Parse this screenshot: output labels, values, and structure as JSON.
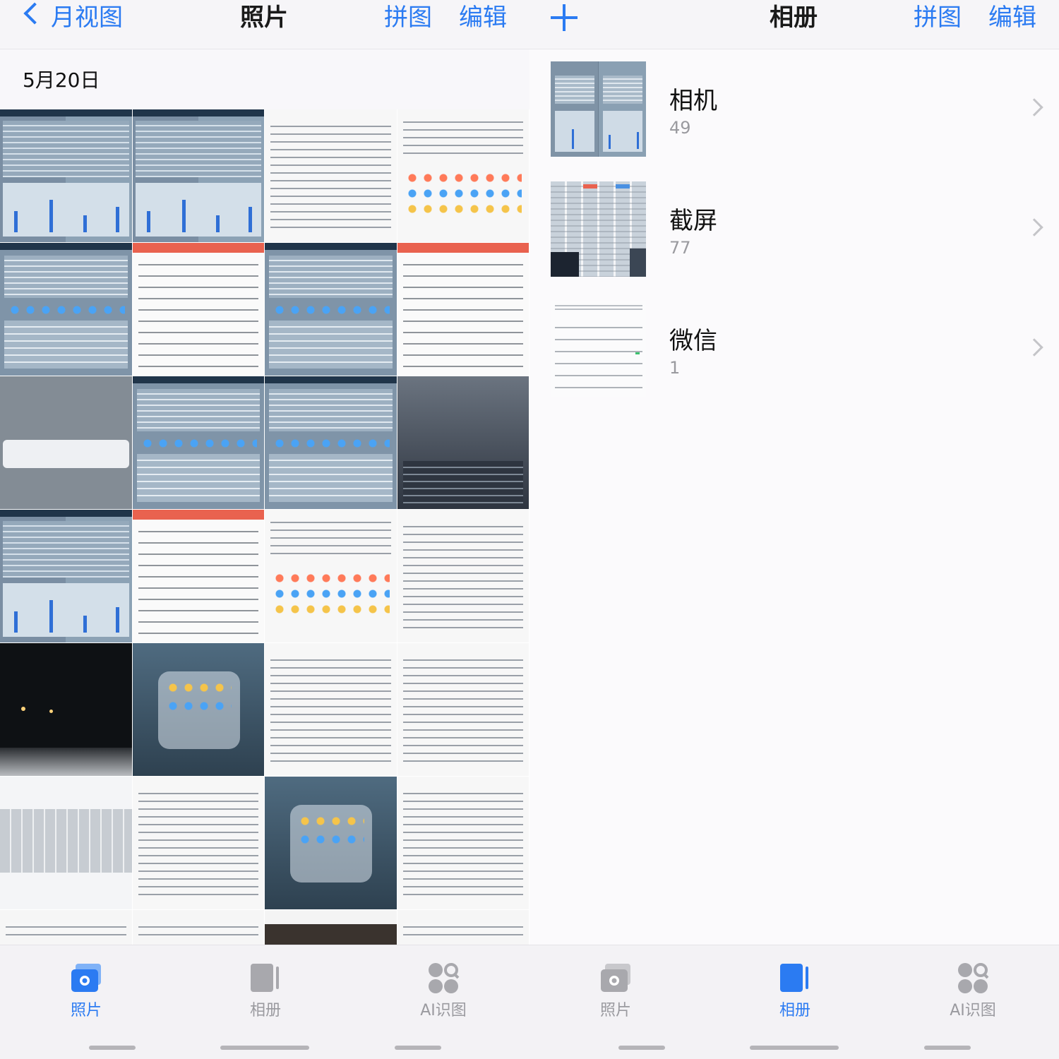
{
  "left": {
    "header": {
      "back_label": "月视图",
      "title": "照片",
      "collage_label": "拼图",
      "edit_label": "编辑"
    },
    "date_label": "5月20日",
    "tabs": [
      {
        "label": "照片",
        "icon": "photos-icon",
        "active": true
      },
      {
        "label": "相册",
        "icon": "albums-icon",
        "active": false
      },
      {
        "label": "AI识图",
        "icon": "ai-recognize-icon",
        "active": false
      }
    ]
  },
  "right": {
    "header": {
      "title": "相册",
      "collage_label": "拼图",
      "edit_label": "编辑"
    },
    "albums": [
      {
        "name": "相机",
        "count": "49"
      },
      {
        "name": "截屏",
        "count": "77"
      },
      {
        "name": "微信",
        "count": "1"
      }
    ],
    "tabs": [
      {
        "label": "照片",
        "icon": "photos-icon",
        "active": false
      },
      {
        "label": "相册",
        "icon": "albums-icon",
        "active": true
      },
      {
        "label": "AI识图",
        "icon": "ai-recognize-icon",
        "active": false
      }
    ]
  },
  "colors": {
    "accent": "#2b7bf2",
    "inactive_tab": "#9a9a9f",
    "background": "#f8f7fa"
  }
}
